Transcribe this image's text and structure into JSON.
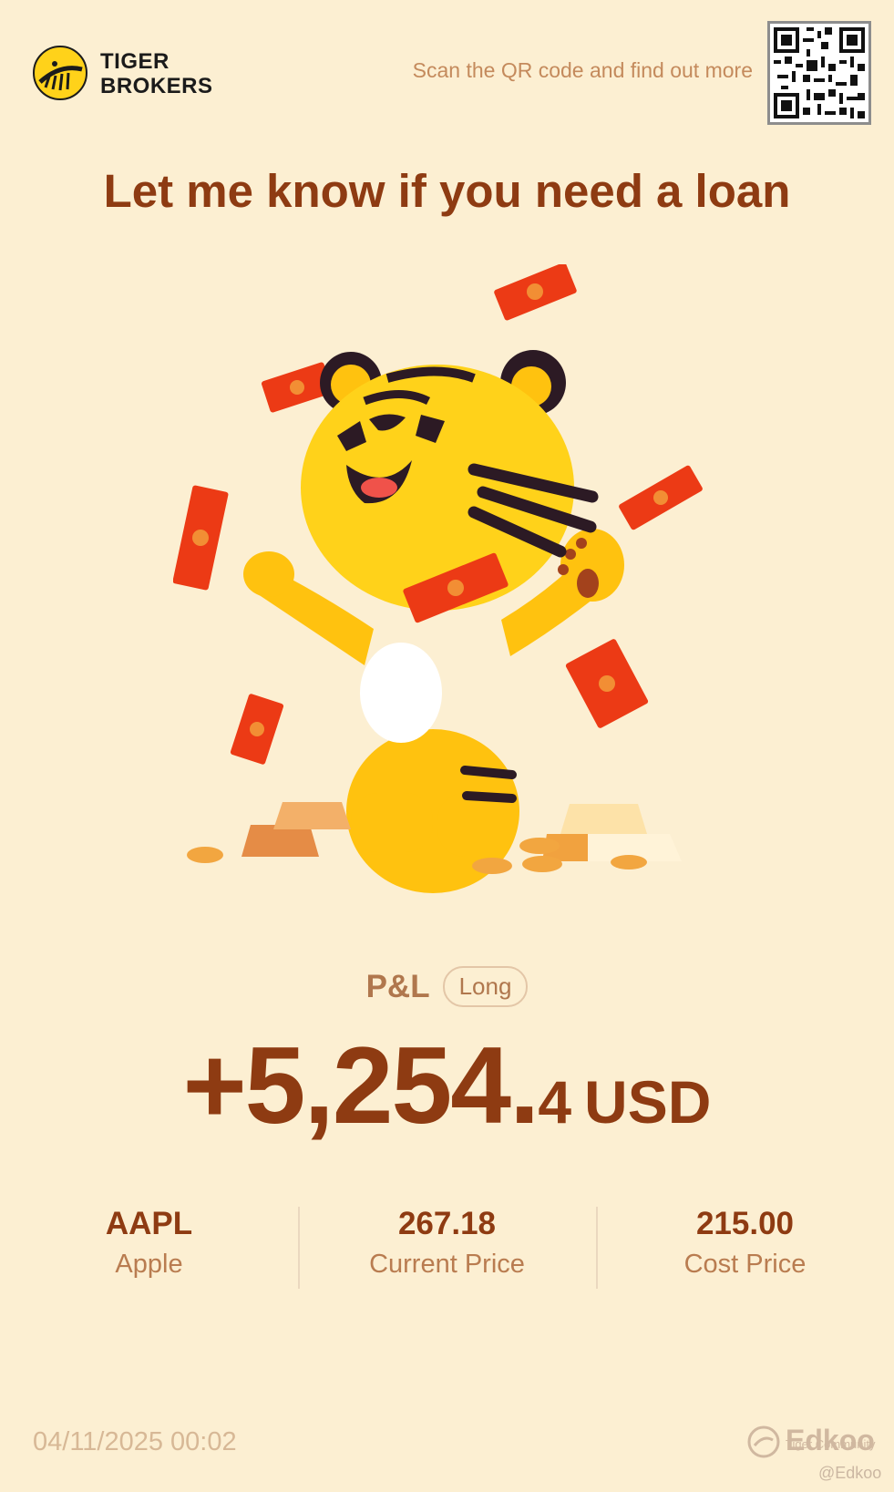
{
  "header": {
    "brand_line1": "TIGER",
    "brand_line2": "BROKERS",
    "scan_text": "Scan the QR code and find out more"
  },
  "headline": "Let me know if you need a loan",
  "pl": {
    "label": "P&L",
    "position": "Long",
    "amount_main": "+5,254.",
    "amount_fraction": "4",
    "currency": "USD"
  },
  "stats": [
    {
      "value": "AAPL",
      "label": "Apple"
    },
    {
      "value": "267.18",
      "label": "Current Price"
    },
    {
      "value": "215.00",
      "label": "Cost Price"
    }
  ],
  "footer": {
    "timestamp": "04/11/2025 00:02",
    "watermark_name": "Edkoo",
    "watermark_sub": "Tiger Community",
    "watermark_handle": "@Edkoo"
  },
  "colors": {
    "background": "#fcefd2",
    "accent_brown": "#8e3b12",
    "muted_brown": "#b97c50",
    "tiger_yellow": "#ffd21a",
    "envelope_red": "#ec3a15"
  },
  "icons": {
    "logo": "tiger-brokers-logo-icon",
    "qr": "qr-code-icon",
    "mascot": "tiger-mascot-illustration"
  }
}
